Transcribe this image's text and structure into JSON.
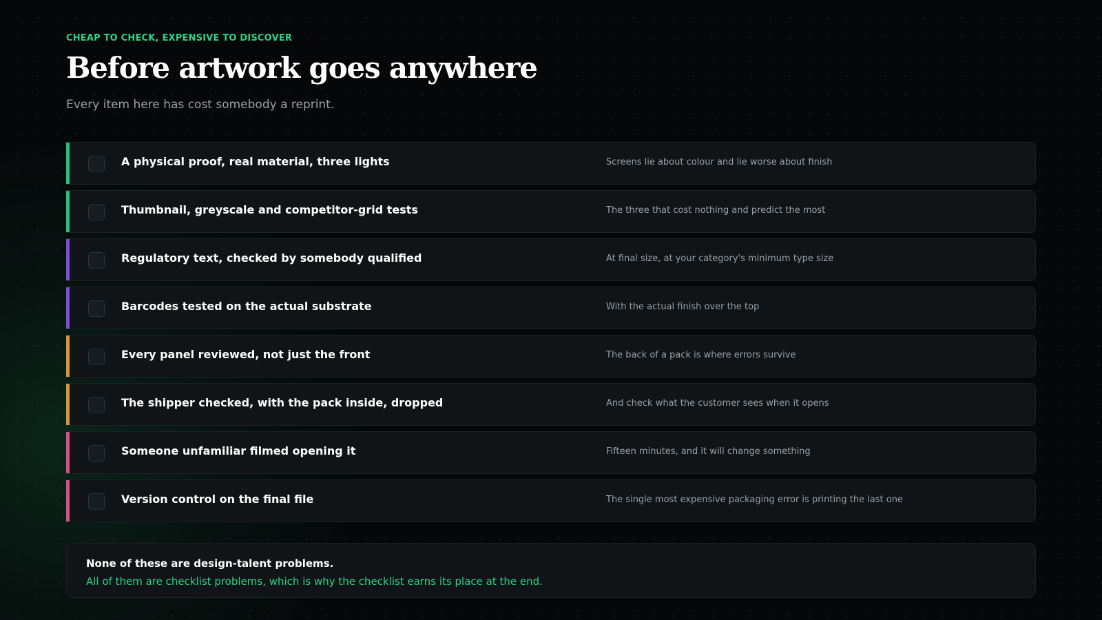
{
  "header": {
    "eyebrow": "CHEAP TO CHECK, EXPENSIVE TO DISCOVER",
    "title": "Before artwork goes anywhere",
    "subtitle": "Every item here has cost somebody a reprint."
  },
  "colors": {
    "green": "#22c27e",
    "purple": "#7b4fd6",
    "amber": "#d9982e",
    "pink": "#d64f86",
    "eyebrow": "#2ad38a"
  },
  "checklist": [
    {
      "title": "A physical proof, real material, three lights",
      "note": "Screens lie about colour and lie worse about finish",
      "accent": "#22c27e",
      "checked": false
    },
    {
      "title": "Thumbnail, greyscale and competitor-grid tests",
      "note": "The three that cost nothing and predict the most",
      "accent": "#22c27e",
      "checked": false
    },
    {
      "title": "Regulatory text, checked by somebody qualified",
      "note": "At final size, at your category's minimum type size",
      "accent": "#7b4fd6",
      "checked": false
    },
    {
      "title": "Barcodes tested on the actual substrate",
      "note": "With the actual finish over the top",
      "accent": "#7b4fd6",
      "checked": false
    },
    {
      "title": "Every panel reviewed, not just the front",
      "note": "The back of a pack is where errors survive",
      "accent": "#d9982e",
      "checked": false
    },
    {
      "title": "The shipper checked, with the pack inside, dropped",
      "note": "And check what the customer sees when it opens",
      "accent": "#d9982e",
      "checked": false
    },
    {
      "title": "Someone unfamiliar filmed opening it",
      "note": "Fifteen minutes, and it will change something",
      "accent": "#d64f86",
      "checked": false
    },
    {
      "title": "Version control on the final file",
      "note": "The single most expensive packaging error is printing the last one",
      "accent": "#d64f86",
      "checked": false
    }
  ],
  "callout": {
    "line1": "None of these are design-talent problems.",
    "line2": "All of them are checklist problems, which is why the checklist earns its place at the end."
  }
}
